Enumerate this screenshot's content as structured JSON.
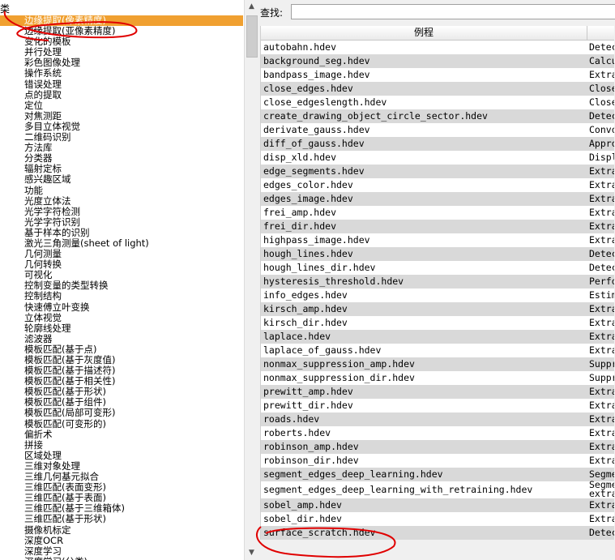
{
  "left": {
    "header": "类",
    "items": [
      "边缘提取(像素精度)",
      "边缘提取(亚像素精度)",
      "变化的模板",
      "并行处理",
      "彩色图像处理",
      "操作系统",
      "错误处理",
      "点的提取",
      "定位",
      "对焦测距",
      "多目立体视觉",
      "二维码识别",
      "方法库",
      "分类器",
      "辐射定标",
      "感兴趣区域",
      "功能",
      "光度立体法",
      "光学字符检测",
      "光学字符识别",
      "基于样本的识别",
      "激光三角测量(sheet of light)",
      "几何测量",
      "几何转换",
      "可视化",
      "控制变量的类型转换",
      "控制结构",
      "快速傅立叶变换",
      "立体视觉",
      "轮廓线处理",
      "滤波器",
      "模板匹配(基于点)",
      "模板匹配(基于灰度值)",
      "模板匹配(基于描述符)",
      "模板匹配(基于相关性)",
      "模板匹配(基于形状)",
      "模板匹配(基于组件)",
      "模板匹配(局部可变形)",
      "模板匹配(可变形的)",
      "偏折术",
      "拼接",
      "区域处理",
      "三维对象处理",
      "三维几何基元拟合",
      "三维匹配(表面变形)",
      "三维匹配(基于表面)",
      "三维匹配(基于三维箱体)",
      "三维匹配(基于形状)",
      "摄像机标定",
      "深度OCR",
      "深度学习",
      "深度学习(分类)"
    ],
    "selected_index": 0
  },
  "right": {
    "search_label": "查找:",
    "search_value": "",
    "column_name": "例程",
    "column_desc": "",
    "rows": [
      {
        "name": "autobahn.hdev",
        "desc": "Detec"
      },
      {
        "name": "background_seg.hdev",
        "desc": "Calcu"
      },
      {
        "name": "bandpass_image.hdev",
        "desc": "Extra"
      },
      {
        "name": "close_edges.hdev",
        "desc": "Close"
      },
      {
        "name": "close_edgeslength.hdev",
        "desc": "Close"
      },
      {
        "name": "create_drawing_object_circle_sector.hdev",
        "desc": "Detec"
      },
      {
        "name": "derivate_gauss.hdev",
        "desc": "Convo"
      },
      {
        "name": "diff_of_gauss.hdev",
        "desc": "Appro"
      },
      {
        "name": "disp_xld.hdev",
        "desc": "Displ"
      },
      {
        "name": "edge_segments.hdev",
        "desc": "Extra"
      },
      {
        "name": "edges_color.hdev",
        "desc": "Extra"
      },
      {
        "name": "edges_image.hdev",
        "desc": "Extra"
      },
      {
        "name": "frei_amp.hdev",
        "desc": "Extra"
      },
      {
        "name": "frei_dir.hdev",
        "desc": "Extra"
      },
      {
        "name": "highpass_image.hdev",
        "desc": "Extra"
      },
      {
        "name": "hough_lines.hdev",
        "desc": "Detec"
      },
      {
        "name": "hough_lines_dir.hdev",
        "desc": "Detec"
      },
      {
        "name": "hysteresis_threshold.hdev",
        "desc": "Perfo"
      },
      {
        "name": "info_edges.hdev",
        "desc": "Estim"
      },
      {
        "name": "kirsch_amp.hdev",
        "desc": "Extra"
      },
      {
        "name": "kirsch_dir.hdev",
        "desc": "Extra"
      },
      {
        "name": "laplace.hdev",
        "desc": "Extra"
      },
      {
        "name": "laplace_of_gauss.hdev",
        "desc": "Extra"
      },
      {
        "name": "nonmax_suppression_amp.hdev",
        "desc": "Suppr"
      },
      {
        "name": "nonmax_suppression_dir.hdev",
        "desc": "Suppr"
      },
      {
        "name": "prewitt_amp.hdev",
        "desc": "Extra"
      },
      {
        "name": "prewitt_dir.hdev",
        "desc": "Extra"
      },
      {
        "name": "roads.hdev",
        "desc": "Extra"
      },
      {
        "name": "roberts.hdev",
        "desc": "Extra"
      },
      {
        "name": "robinson_amp.hdev",
        "desc": "Extra"
      },
      {
        "name": "robinson_dir.hdev",
        "desc": "Extra"
      },
      {
        "name": "segment_edges_deep_learning.hdev",
        "desc": "Segme"
      },
      {
        "name": "segment_edges_deep_learning_with_retraining.hdev",
        "desc": "Segme extra",
        "tall": true
      },
      {
        "name": "sobel_amp.hdev",
        "desc": "Extra"
      },
      {
        "name": "sobel_dir.hdev",
        "desc": "Extra"
      },
      {
        "name": "surface_scratch.hdev",
        "desc": "Detec"
      }
    ]
  },
  "colors": {
    "selection": "#f0a030",
    "row_alt": "#d9d9d9",
    "annotation": "#e00000"
  }
}
